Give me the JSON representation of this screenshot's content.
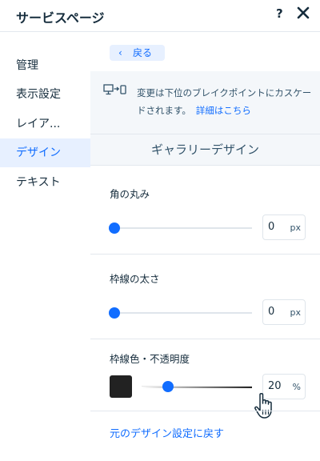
{
  "header": {
    "title": "サービスページ",
    "help_label": "?",
    "close_icon": "close-icon"
  },
  "sidebar": {
    "items": [
      {
        "label": "管理",
        "active": false
      },
      {
        "label": "表示設定",
        "active": false
      },
      {
        "label": "レイア...",
        "active": false
      },
      {
        "label": "デザイン",
        "active": true
      },
      {
        "label": "テキスト",
        "active": false
      }
    ]
  },
  "panel": {
    "back_label": "戻る",
    "notice": {
      "icon": "devices-icon",
      "text": "変更は下位のブレイクポイントにカスケードされます。",
      "link_label": "詳細はこちら"
    },
    "section_title": "ギャラリーデザイン",
    "corner_radius": {
      "label": "角の丸み",
      "value": "0",
      "unit": "px"
    },
    "border_width": {
      "label": "枠線の太さ",
      "value": "0",
      "unit": "px"
    },
    "border_color": {
      "label": "枠線色・不透明度",
      "color": "#222222",
      "opacity": "20",
      "unit": "%"
    },
    "reset_label": "元のデザイン設定に戻す"
  },
  "colors": {
    "accent": "#116dff",
    "active_bg": "#e7f0ff",
    "notice_bg": "#f4f7fa"
  }
}
